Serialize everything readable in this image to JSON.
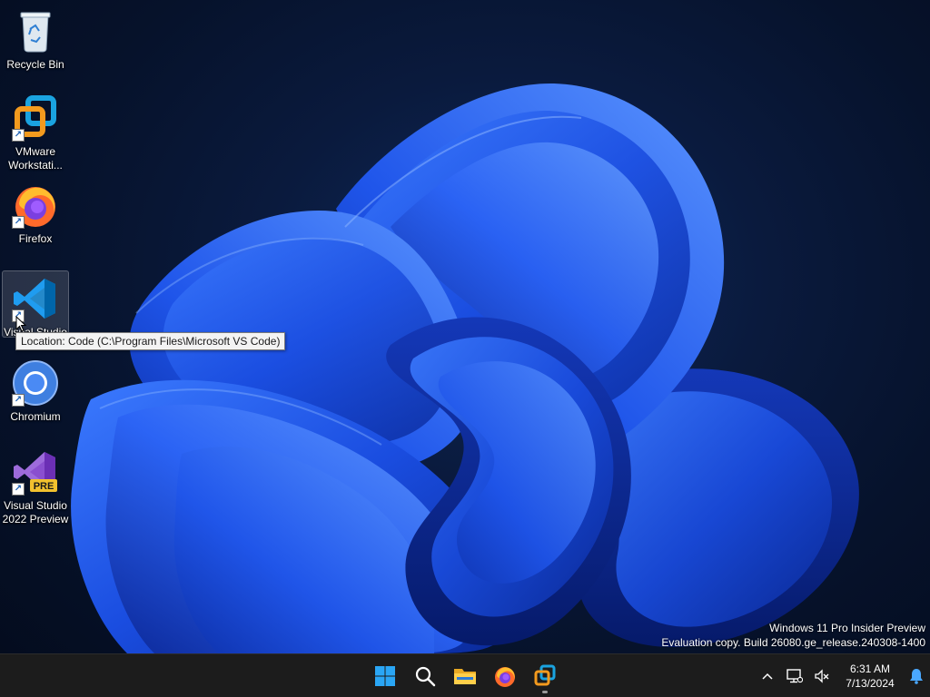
{
  "desktop": {
    "icons": [
      {
        "label": "Recycle Bin",
        "icon": "recycle-bin-icon"
      },
      {
        "label": "VMware\nWorkstati...",
        "icon": "vmware-icon"
      },
      {
        "label": "Firefox",
        "icon": "firefox-icon"
      },
      {
        "label": "Visual Studio",
        "icon": "vscode-icon"
      },
      {
        "label": "Chromium",
        "icon": "chromium-icon"
      },
      {
        "label": "Visual Studio\n2022 Preview",
        "icon": "visual-studio-preview-icon"
      }
    ],
    "preview_badge": "PRE"
  },
  "tooltip": {
    "text": "Location: Code (C:\\Program Files\\Microsoft VS Code)"
  },
  "watermark": {
    "line1": "Windows 11 Pro Insider Preview",
    "line2": "Evaluation copy. Build 26080.ge_release.240308-1400"
  },
  "taskbar": {
    "pinned": [
      "start-icon",
      "search-icon",
      "file-explorer-icon",
      "firefox-icon",
      "vmware-icon"
    ],
    "clock": {
      "time": "6:31 AM",
      "date": "7/13/2024"
    }
  },
  "colors": {
    "accent": "#0067c0",
    "taskbar_bg": "#1c1c1c",
    "bloom": "#1e50e6"
  }
}
